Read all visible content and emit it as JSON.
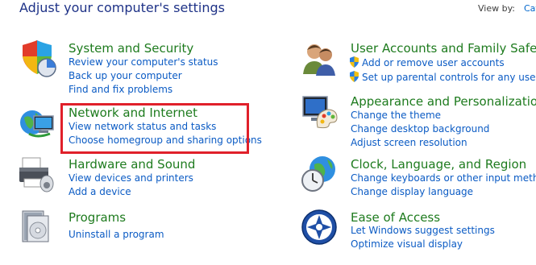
{
  "header": {
    "title": "Adjust your computer's settings",
    "view_by_label": "View by:",
    "view_by_value": "Cat"
  },
  "left": [
    {
      "icon": "shield-security-icon",
      "title": "System and Security",
      "links": [
        "Review your computer's status",
        "Back up your computer",
        "Find and fix problems"
      ]
    },
    {
      "icon": "network-globe-icon",
      "title": "Network and Internet",
      "links": [
        "View network status and tasks",
        "Choose homegroup and sharing options"
      ]
    },
    {
      "icon": "printer-icon",
      "title": "Hardware and Sound",
      "links": [
        "View devices and printers",
        "Add a device"
      ]
    },
    {
      "icon": "programs-icon",
      "title": "Programs",
      "links": [
        "Uninstall a program"
      ]
    }
  ],
  "right": [
    {
      "icon": "users-icon",
      "title": "User Accounts and Family Safety",
      "links": [
        "Add or remove user accounts",
        "Set up parental controls for any user"
      ]
    },
    {
      "icon": "monitor-palette-icon",
      "title": "Appearance and Personalization",
      "links": [
        "Change the theme",
        "Change desktop background",
        "Adjust screen resolution"
      ]
    },
    {
      "icon": "clock-globe-icon",
      "title": "Clock, Language, and Region",
      "links": [
        "Change keyboards or other input methods",
        "Change display language"
      ]
    },
    {
      "icon": "ease-of-access-icon",
      "title": "Ease of Access",
      "links": [
        "Let Windows suggest settings",
        "Optimize visual display"
      ]
    }
  ]
}
